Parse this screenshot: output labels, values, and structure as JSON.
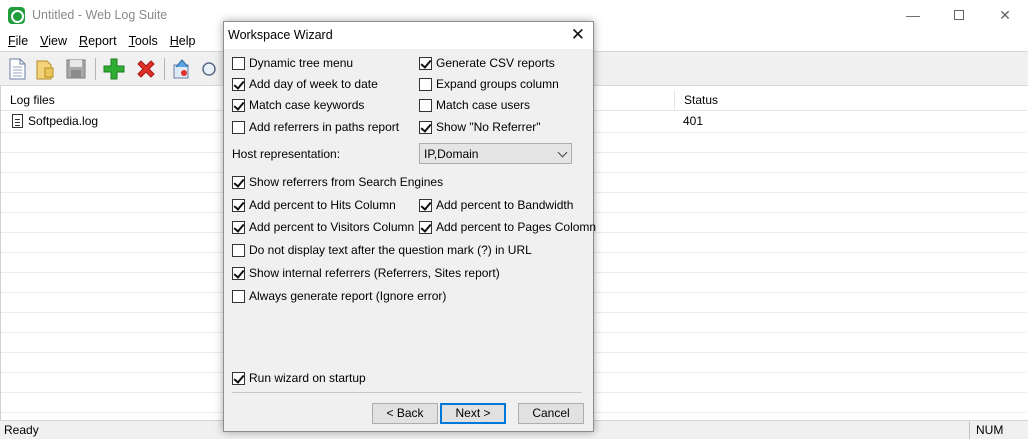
{
  "window": {
    "title": "Untitled - Web Log Suite",
    "minimize": "—",
    "close": "✕"
  },
  "menu": {
    "items": [
      {
        "first": "F",
        "rest": "ile"
      },
      {
        "first": "V",
        "rest": "iew"
      },
      {
        "first": "R",
        "rest": "eport"
      },
      {
        "first": "T",
        "rest": "ools"
      },
      {
        "first": "H",
        "rest": "elp"
      }
    ]
  },
  "list": {
    "columns": [
      "Log files",
      "Status"
    ],
    "rows": [
      {
        "file": "Softpedia.log",
        "status": "401"
      }
    ]
  },
  "statusbar": {
    "text": "Ready",
    "num": "NUM"
  },
  "dialog": {
    "title": "Workspace Wizard",
    "close": "✕",
    "checkboxes": {
      "dynamic_tree_menu": {
        "label": "Dynamic tree menu",
        "checked": false
      },
      "generate_csv": {
        "label": "Generate CSV reports",
        "checked": true
      },
      "add_day_of_week": {
        "label": "Add day of week to date",
        "checked": true
      },
      "expand_groups": {
        "label": "Expand groups column",
        "checked": false
      },
      "match_case_keywords": {
        "label": "Match case keywords",
        "checked": true
      },
      "match_case_users": {
        "label": "Match case users",
        "checked": false
      },
      "add_referrers_paths": {
        "label": "Add referrers in paths report",
        "checked": false
      },
      "show_no_referrer": {
        "label": "Show \"No Referrer\"",
        "checked": true
      },
      "show_referrers_search": {
        "label": "Show referrers from Search Engines",
        "checked": true
      },
      "percent_hits": {
        "label": "Add percent to Hits Column",
        "checked": true
      },
      "percent_bandwidth": {
        "label": "Add percent to Bandwidth",
        "checked": true
      },
      "percent_visitors": {
        "label": "Add percent to Visitors Column",
        "checked": true
      },
      "percent_pages": {
        "label": "Add percent to Pages Colomn",
        "checked": true
      },
      "no_text_after_qmark": {
        "label": "Do not display text after the question mark (?) in URL",
        "checked": false
      },
      "show_internal_referrers": {
        "label": "Show internal referrers (Referrers, Sites report)",
        "checked": true
      },
      "always_generate": {
        "label": "Always generate report (Ignore error)",
        "checked": false
      },
      "run_wizard_startup": {
        "label": "Run wizard on startup",
        "checked": true
      }
    },
    "host_representation": {
      "label": "Host representation:",
      "value": "IP,Domain"
    },
    "buttons": {
      "back": "< Back",
      "next": "Next >",
      "cancel": "Cancel"
    }
  }
}
